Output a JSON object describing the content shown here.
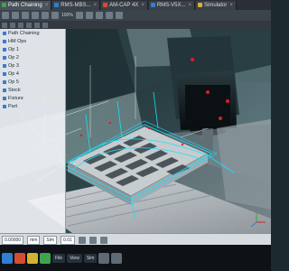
{
  "tabs": [
    {
      "label": "Path Chaining",
      "color": "#3fa34d"
    },
    {
      "label": "RMS-MBS...",
      "color": "#2f7fd3"
    },
    {
      "label": "AM-CAP 4X",
      "color": "#d34d2f"
    },
    {
      "label": "RMS-V5X...",
      "color": "#2f7fd3"
    },
    {
      "label": "Simulator",
      "color": "#d3b32f"
    }
  ],
  "toolbar": {
    "zoom_label": "100%"
  },
  "sidebar": {
    "items": [
      "Path Chaining",
      "HM Ops",
      "Op 1",
      "Op 2",
      "Op 3",
      "Op 4",
      "Op 5",
      "Stock",
      "Fixture",
      "Part"
    ]
  },
  "statusbar": {
    "coord": "0.00000",
    "units": "mm",
    "sim": "Sim",
    "tolerance": "0.01"
  },
  "colors": {
    "machine_dark": "#2b3f44",
    "machine_glass": "#7aa9a9",
    "toolpath": "#19e0ff",
    "head": "#0f1418",
    "accent_red": "#e01a2b",
    "table": "#b7bcc1"
  },
  "taskbar": {
    "items": [
      "File",
      "View",
      "Sim"
    ]
  }
}
